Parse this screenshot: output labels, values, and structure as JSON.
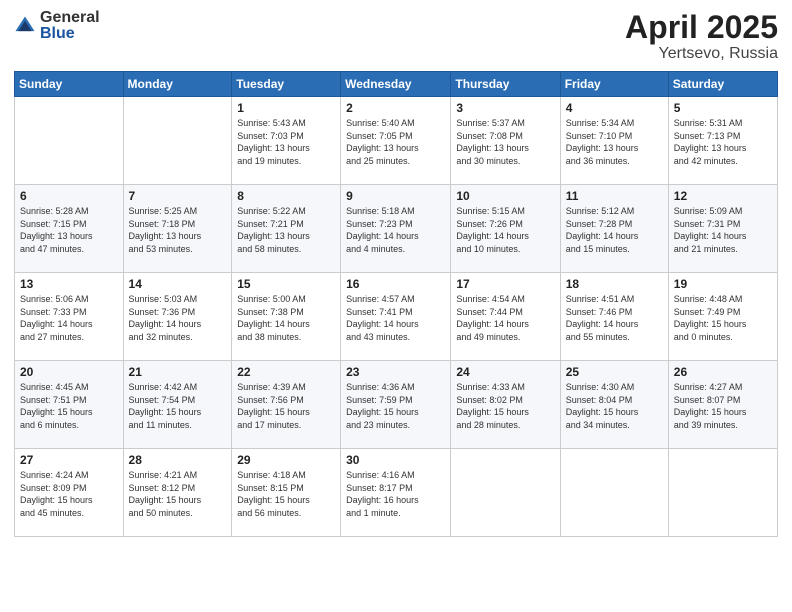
{
  "logo": {
    "general": "General",
    "blue": "Blue"
  },
  "title": {
    "month_year": "April 2025",
    "location": "Yertsevo, Russia"
  },
  "weekdays": [
    "Sunday",
    "Monday",
    "Tuesday",
    "Wednesday",
    "Thursday",
    "Friday",
    "Saturday"
  ],
  "weeks": [
    [
      {
        "day": "",
        "text": ""
      },
      {
        "day": "",
        "text": ""
      },
      {
        "day": "1",
        "text": "Sunrise: 5:43 AM\nSunset: 7:03 PM\nDaylight: 13 hours\nand 19 minutes."
      },
      {
        "day": "2",
        "text": "Sunrise: 5:40 AM\nSunset: 7:05 PM\nDaylight: 13 hours\nand 25 minutes."
      },
      {
        "day": "3",
        "text": "Sunrise: 5:37 AM\nSunset: 7:08 PM\nDaylight: 13 hours\nand 30 minutes."
      },
      {
        "day": "4",
        "text": "Sunrise: 5:34 AM\nSunset: 7:10 PM\nDaylight: 13 hours\nand 36 minutes."
      },
      {
        "day": "5",
        "text": "Sunrise: 5:31 AM\nSunset: 7:13 PM\nDaylight: 13 hours\nand 42 minutes."
      }
    ],
    [
      {
        "day": "6",
        "text": "Sunrise: 5:28 AM\nSunset: 7:15 PM\nDaylight: 13 hours\nand 47 minutes."
      },
      {
        "day": "7",
        "text": "Sunrise: 5:25 AM\nSunset: 7:18 PM\nDaylight: 13 hours\nand 53 minutes."
      },
      {
        "day": "8",
        "text": "Sunrise: 5:22 AM\nSunset: 7:21 PM\nDaylight: 13 hours\nand 58 minutes."
      },
      {
        "day": "9",
        "text": "Sunrise: 5:18 AM\nSunset: 7:23 PM\nDaylight: 14 hours\nand 4 minutes."
      },
      {
        "day": "10",
        "text": "Sunrise: 5:15 AM\nSunset: 7:26 PM\nDaylight: 14 hours\nand 10 minutes."
      },
      {
        "day": "11",
        "text": "Sunrise: 5:12 AM\nSunset: 7:28 PM\nDaylight: 14 hours\nand 15 minutes."
      },
      {
        "day": "12",
        "text": "Sunrise: 5:09 AM\nSunset: 7:31 PM\nDaylight: 14 hours\nand 21 minutes."
      }
    ],
    [
      {
        "day": "13",
        "text": "Sunrise: 5:06 AM\nSunset: 7:33 PM\nDaylight: 14 hours\nand 27 minutes."
      },
      {
        "day": "14",
        "text": "Sunrise: 5:03 AM\nSunset: 7:36 PM\nDaylight: 14 hours\nand 32 minutes."
      },
      {
        "day": "15",
        "text": "Sunrise: 5:00 AM\nSunset: 7:38 PM\nDaylight: 14 hours\nand 38 minutes."
      },
      {
        "day": "16",
        "text": "Sunrise: 4:57 AM\nSunset: 7:41 PM\nDaylight: 14 hours\nand 43 minutes."
      },
      {
        "day": "17",
        "text": "Sunrise: 4:54 AM\nSunset: 7:44 PM\nDaylight: 14 hours\nand 49 minutes."
      },
      {
        "day": "18",
        "text": "Sunrise: 4:51 AM\nSunset: 7:46 PM\nDaylight: 14 hours\nand 55 minutes."
      },
      {
        "day": "19",
        "text": "Sunrise: 4:48 AM\nSunset: 7:49 PM\nDaylight: 15 hours\nand 0 minutes."
      }
    ],
    [
      {
        "day": "20",
        "text": "Sunrise: 4:45 AM\nSunset: 7:51 PM\nDaylight: 15 hours\nand 6 minutes."
      },
      {
        "day": "21",
        "text": "Sunrise: 4:42 AM\nSunset: 7:54 PM\nDaylight: 15 hours\nand 11 minutes."
      },
      {
        "day": "22",
        "text": "Sunrise: 4:39 AM\nSunset: 7:56 PM\nDaylight: 15 hours\nand 17 minutes."
      },
      {
        "day": "23",
        "text": "Sunrise: 4:36 AM\nSunset: 7:59 PM\nDaylight: 15 hours\nand 23 minutes."
      },
      {
        "day": "24",
        "text": "Sunrise: 4:33 AM\nSunset: 8:02 PM\nDaylight: 15 hours\nand 28 minutes."
      },
      {
        "day": "25",
        "text": "Sunrise: 4:30 AM\nSunset: 8:04 PM\nDaylight: 15 hours\nand 34 minutes."
      },
      {
        "day": "26",
        "text": "Sunrise: 4:27 AM\nSunset: 8:07 PM\nDaylight: 15 hours\nand 39 minutes."
      }
    ],
    [
      {
        "day": "27",
        "text": "Sunrise: 4:24 AM\nSunset: 8:09 PM\nDaylight: 15 hours\nand 45 minutes."
      },
      {
        "day": "28",
        "text": "Sunrise: 4:21 AM\nSunset: 8:12 PM\nDaylight: 15 hours\nand 50 minutes."
      },
      {
        "day": "29",
        "text": "Sunrise: 4:18 AM\nSunset: 8:15 PM\nDaylight: 15 hours\nand 56 minutes."
      },
      {
        "day": "30",
        "text": "Sunrise: 4:16 AM\nSunset: 8:17 PM\nDaylight: 16 hours\nand 1 minute."
      },
      {
        "day": "",
        "text": ""
      },
      {
        "day": "",
        "text": ""
      },
      {
        "day": "",
        "text": ""
      }
    ]
  ]
}
